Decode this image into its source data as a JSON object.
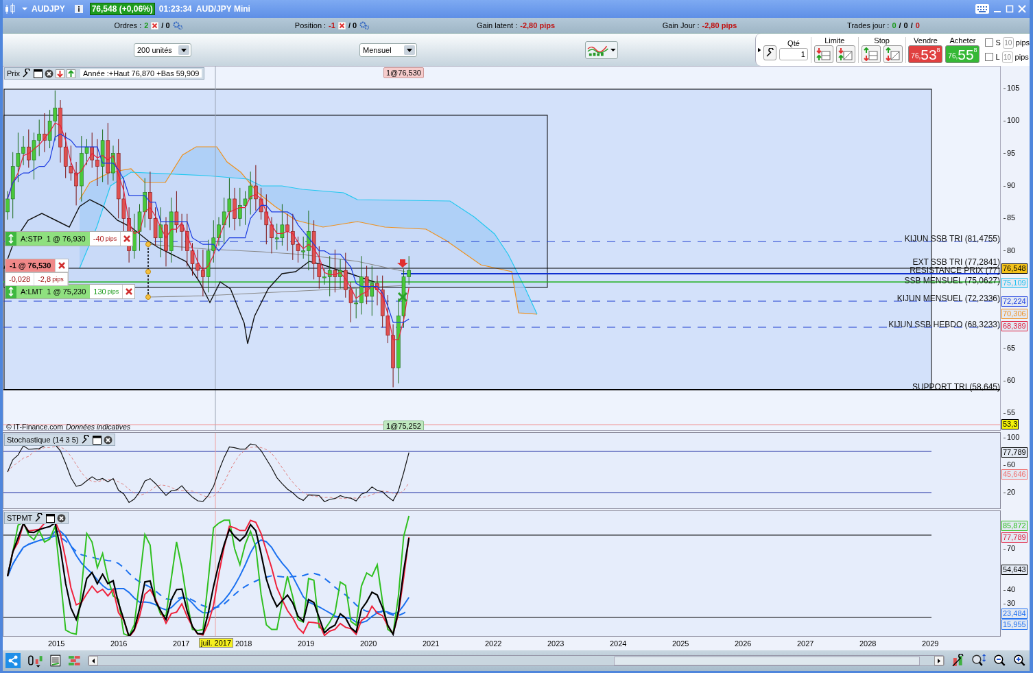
{
  "title_bar": {
    "symbol": "AUDJPY",
    "price": "76,548 (+0,06%)",
    "time": "01:23:34",
    "instrument": "AUD/JPY Mini"
  },
  "info_bar": {
    "orders": {
      "label": "Ordres :",
      "count": "2",
      "pending": "/ 0"
    },
    "position": {
      "label": "Position :",
      "count": "-1",
      "pending": "/ 0"
    },
    "gain_latent": {
      "label": "Gain latent :",
      "value": "-2,80 pips"
    },
    "gain_jour": {
      "label": "Gain Jour :",
      "value": "-2,80 pips"
    },
    "trades_jour": {
      "label": "Trades jour :",
      "won": "0",
      "sep_1": "/",
      "total": "0",
      "sep_2": "/",
      "lost": "0"
    }
  },
  "toolbar": {
    "quantity_select": "200 unités",
    "period_select": "Mensuel"
  },
  "order_panel": {
    "qty_label": "Qté",
    "qty_value": "1",
    "limit_label": "Limite",
    "stop_label": "Stop",
    "sell": {
      "label": "Vendre",
      "small": "76,",
      "main": "53",
      "sup": "8"
    },
    "buy": {
      "label": "Acheter",
      "small": "76,",
      "main": "55",
      "sup": "8"
    },
    "options": [
      {
        "label": "S",
        "checked": false,
        "pips": "10",
        "unit": "pips"
      },
      {
        "label": "L",
        "checked": false,
        "pips": "10",
        "unit": "pips"
      }
    ]
  },
  "price_panel": {
    "title": "Prix",
    "legend": "Année :+Haut 76,870 +Bas 59,909",
    "top_marker": "1@76,530",
    "bottom_marker": "1@75,252",
    "copyright": "© IT-Finance.com",
    "disclaimer": "Données indicatives",
    "levels": [
      {
        "label": "KIJUN SSB TRI (81,4755)"
      },
      {
        "label": "EXT SSB TRI (77,2841)"
      },
      {
        "label": "RESISTANCE PRIX (77)"
      },
      {
        "label": "SSB MENSUEL (75,0627)"
      },
      {
        "label": "KIJUN MENSUEL (72,2336)"
      },
      {
        "label": "KIJUN SSB HEBDO (68,3233)"
      },
      {
        "label": "SUPPORT TRI (58,645)"
      }
    ],
    "orders": [
      {
        "kind": "stop",
        "label": "A:STP  1 @ 76,930",
        "pips": "-40",
        "unit": "pips"
      },
      {
        "kind": "limit",
        "label": "A:LMT  1 @ 75,230",
        "pips": "130",
        "unit": "pips"
      }
    ],
    "position": {
      "label": "-1 @ 76,530",
      "value": "-0,028",
      "pips": "-2,8",
      "unit": "pips"
    },
    "axis_ticks": [
      "105",
      "100",
      "95",
      "90",
      "85",
      "80",
      "65",
      "60",
      "55"
    ],
    "tags": [
      {
        "text": "76,548",
        "kind": "current",
        "color": "#000000"
      },
      {
        "text": "75,109",
        "kind": "line",
        "color": "#20c0f0"
      },
      {
        "text": "72,224",
        "kind": "line",
        "color": "#2040e0"
      },
      {
        "text": "70,306",
        "kind": "line",
        "color": "#f09020"
      },
      {
        "text": "68,389",
        "kind": "line",
        "color": "#e02040"
      },
      {
        "text": "53,3",
        "kind": "alert",
        "color": "#000000"
      }
    ]
  },
  "stochastic": {
    "title": "Stochastique (14 3 5)",
    "axis_ticks": [
      "100",
      "60",
      "20"
    ],
    "tags": [
      {
        "text": "77,789",
        "kind": "line",
        "color": "#000000"
      },
      {
        "text": "45,646",
        "kind": "line",
        "color": "#f07070"
      }
    ]
  },
  "stpmt": {
    "title": "STPMT",
    "axis_ticks": [
      "70",
      "40",
      "30"
    ],
    "tags": [
      {
        "text": "85,872",
        "kind": "line",
        "color": "#30c020"
      },
      {
        "text": "77,789",
        "kind": "line",
        "color": "#e02040"
      },
      {
        "text": "54,643",
        "kind": "line",
        "color": "#000000"
      },
      {
        "text": "23,484",
        "kind": "line",
        "color": "#2070f0"
      },
      {
        "text": "15,955",
        "kind": "line",
        "color": "#2070f0"
      }
    ]
  },
  "x_axis": {
    "labels": [
      "2015",
      "2016",
      "2017",
      "2018",
      "2019",
      "2020",
      "2021",
      "2022",
      "2023",
      "2024",
      "2025",
      "2026",
      "2027",
      "2028",
      "2029"
    ],
    "cursor_label": "juil. 2017"
  }
}
